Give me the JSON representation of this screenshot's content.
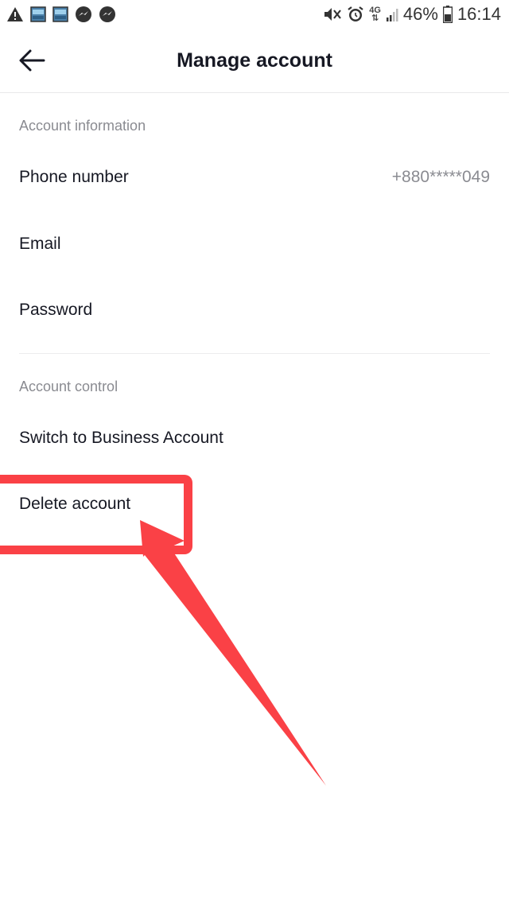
{
  "status_bar": {
    "left_icons": [
      "warning-icon",
      "image-icon",
      "image-icon",
      "messenger-icon",
      "messenger-icon"
    ],
    "right_icons": [
      "mute-icon",
      "alarm-icon",
      "network-4g-icon",
      "signal-icon",
      "battery-icon"
    ],
    "network": "4G",
    "battery": "46%",
    "time": "16:14"
  },
  "header": {
    "title": "Manage account"
  },
  "account_information": {
    "label": "Account information",
    "rows": [
      {
        "label": "Phone number",
        "value": "+880*****049"
      },
      {
        "label": "Email"
      },
      {
        "label": "Password"
      }
    ]
  },
  "account_control": {
    "label": "Account control",
    "rows": [
      {
        "label": "Switch to Business Account"
      },
      {
        "label": "Delete account"
      }
    ]
  },
  "colors": {
    "annotation": "#fa4146",
    "secondary_text": "#8a8b91",
    "primary_text": "#161823"
  }
}
